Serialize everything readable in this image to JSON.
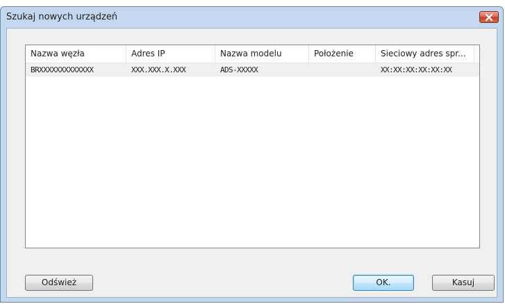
{
  "window": {
    "title": "Szukaj nowych urządzeń"
  },
  "list": {
    "columns": [
      "Nazwa węzła",
      "Adres IP",
      "Nazwa modelu",
      "Położenie",
      "Sieciowy adres spr..."
    ],
    "rows": [
      {
        "node_name": "BRXXXXXXXXXXXXX",
        "ip_address": "XXX.XXX.X.XXX",
        "model_name": "ADS-XXXXX",
        "location": "",
        "mac_address": "XX:XX:XX:XX:XX:XX"
      }
    ]
  },
  "buttons": {
    "refresh": "Odśwież",
    "ok": "OK.",
    "cancel": "Kasuj"
  },
  "icons": {
    "close": "close-icon"
  },
  "colors": {
    "title_bar": "#c3d7ee",
    "client_bg": "#f0f0f0",
    "close_button": "#c3412a",
    "default_button_border": "#3c7fb1",
    "row_bg": "#f0f0f0"
  }
}
